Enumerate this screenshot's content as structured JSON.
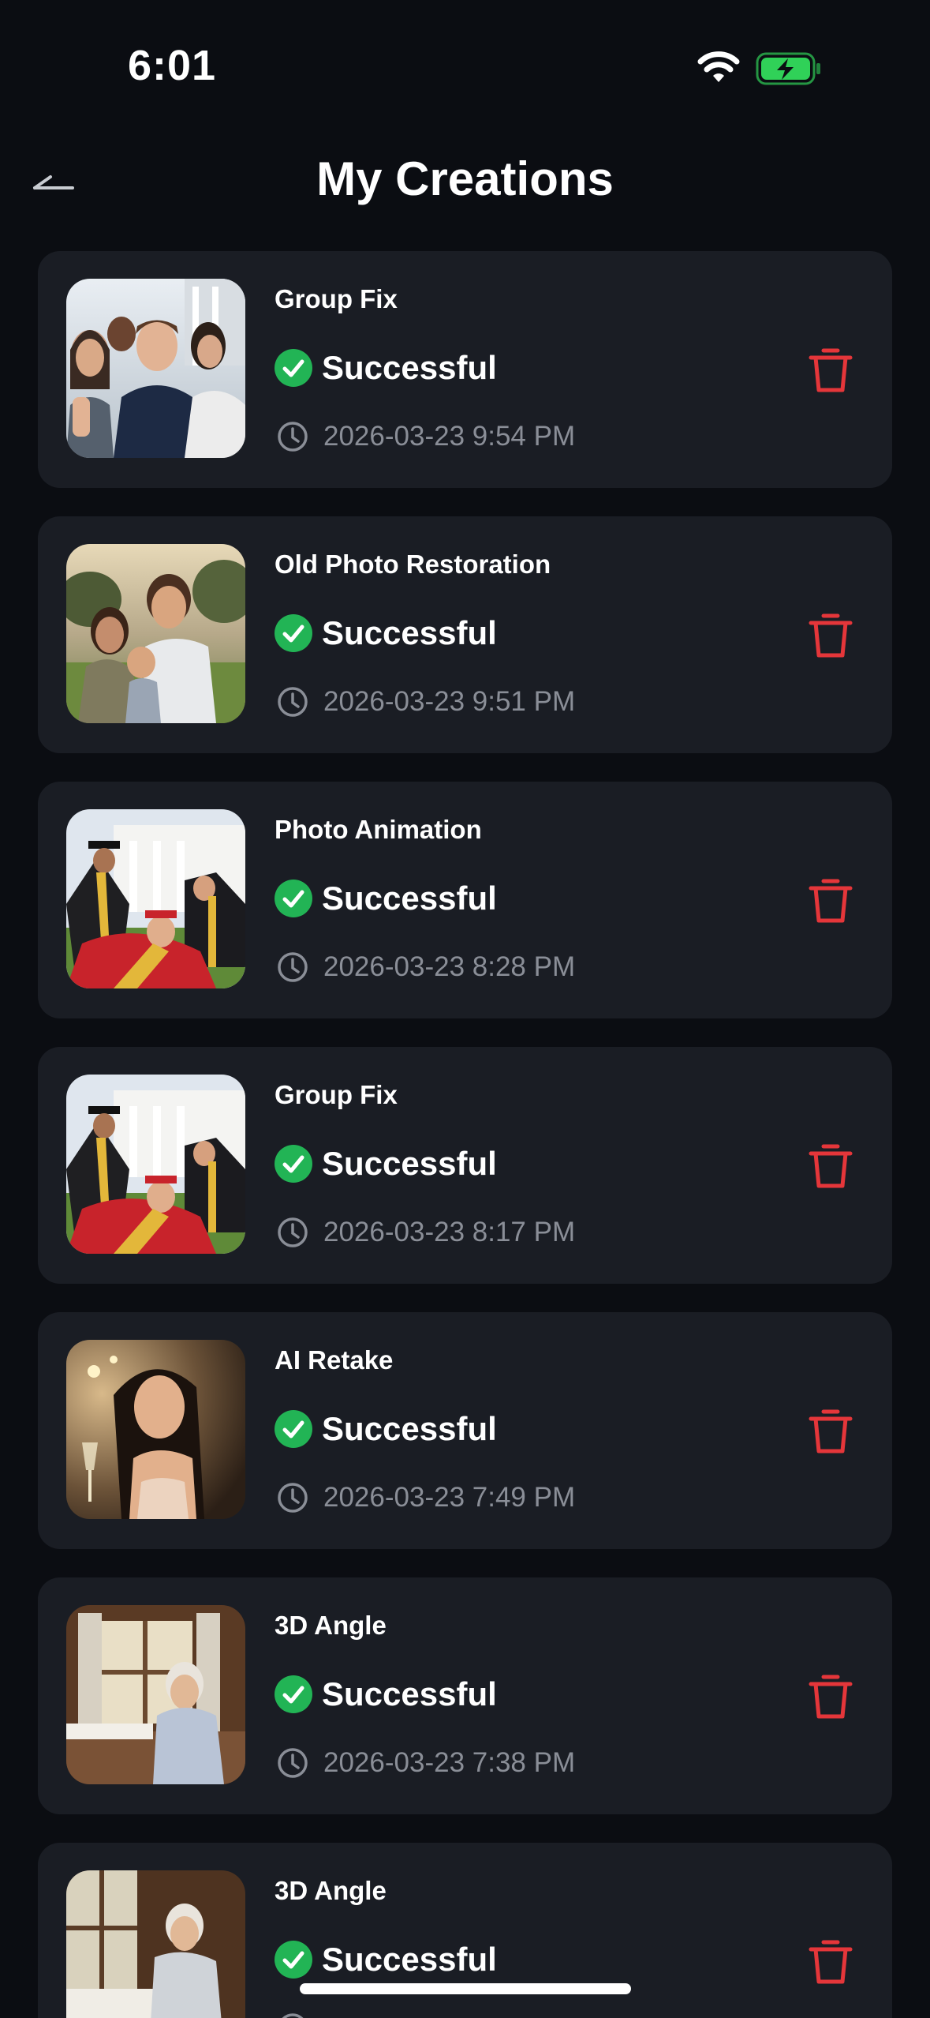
{
  "status_bar": {
    "time": "6:01",
    "wifi_icon": "wifi-icon",
    "battery_icon": "battery-charging-icon",
    "battery_color": "#30d158"
  },
  "header": {
    "back_icon": "back-chevron-icon",
    "title": "My Creations"
  },
  "colors": {
    "background": "#0b0d12",
    "card": "#1a1d24",
    "success": "#22b455",
    "delete": "#e5363a",
    "muted_text": "#8a8e97"
  },
  "creations": [
    {
      "title": "Group Fix",
      "status": "Successful",
      "timestamp": "2026-03-23 9:54 PM",
      "thumbnail": "group-selfie-photo",
      "status_icon": "check-circle-icon",
      "time_icon": "clock-icon",
      "delete_icon": "trash-icon"
    },
    {
      "title": "Old Photo Restoration",
      "status": "Successful",
      "timestamp": "2026-03-23 9:51 PM",
      "thumbnail": "family-portrait-photo",
      "status_icon": "check-circle-icon",
      "time_icon": "clock-icon",
      "delete_icon": "trash-icon"
    },
    {
      "title": "Photo Animation",
      "status": "Successful",
      "timestamp": "2026-03-23 8:28 PM",
      "thumbnail": "graduation-group-photo",
      "status_icon": "check-circle-icon",
      "time_icon": "clock-icon",
      "delete_icon": "trash-icon"
    },
    {
      "title": "Group Fix",
      "status": "Successful",
      "timestamp": "2026-03-23 8:17 PM",
      "thumbnail": "graduation-group-photo",
      "status_icon": "check-circle-icon",
      "time_icon": "clock-icon",
      "delete_icon": "trash-icon"
    },
    {
      "title": "AI Retake",
      "status": "Successful",
      "timestamp": "2026-03-23 7:49 PM",
      "thumbnail": "woman-portrait-photo",
      "status_icon": "check-circle-icon",
      "time_icon": "clock-icon",
      "delete_icon": "trash-icon"
    },
    {
      "title": "3D Angle",
      "status": "Successful",
      "timestamp": "2026-03-23 7:38 PM",
      "thumbnail": "elderly-woman-window-photo",
      "status_icon": "check-circle-icon",
      "time_icon": "clock-icon",
      "delete_icon": "trash-icon"
    },
    {
      "title": "3D Angle",
      "status": "Successful",
      "timestamp": "",
      "thumbnail": "elderly-woman-window-photo",
      "status_icon": "check-circle-icon",
      "time_icon": "clock-icon",
      "delete_icon": "trash-icon"
    }
  ]
}
